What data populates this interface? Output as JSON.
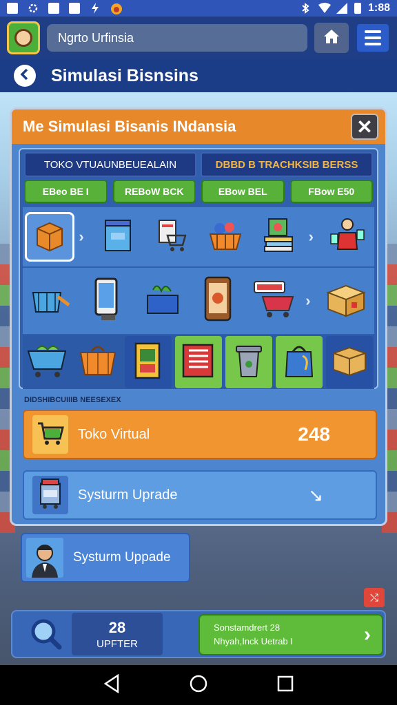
{
  "status_bar": {
    "time": "1:88"
  },
  "app_bar": {
    "search_text": "Ngrto Urfinsia"
  },
  "title_bar": {
    "title": "Simulasi Bisnsins"
  },
  "dialog": {
    "title": "Me  Simulasi Bisanis INdansia",
    "tabs": [
      "TOKO VTUAUNBEUEALAIN",
      "DBBD B TRACHKSIB BERSS"
    ],
    "green_buttons": [
      "EBeo BE I",
      "REBoW BCK",
      "EBow BEL",
      "FBow E50"
    ],
    "sublabel": "DIDSHIBCUIIIB NEESEXEX",
    "cards": [
      {
        "label": "Toko Virtual",
        "value": "248"
      },
      {
        "label": "Systurm Uprade"
      }
    ]
  },
  "upgrade_card": {
    "label": "Systurm Uppade"
  },
  "bottom_bar": {
    "count": "28",
    "count_label": "UPFTER",
    "go_line1": "Sonstamdrert 28",
    "go_line2": "Nhyah,Inck Uetrab I"
  },
  "colors": {
    "accent_orange": "#e7892a",
    "primary_blue": "#1f3e86",
    "green": "#5fbc3a"
  }
}
